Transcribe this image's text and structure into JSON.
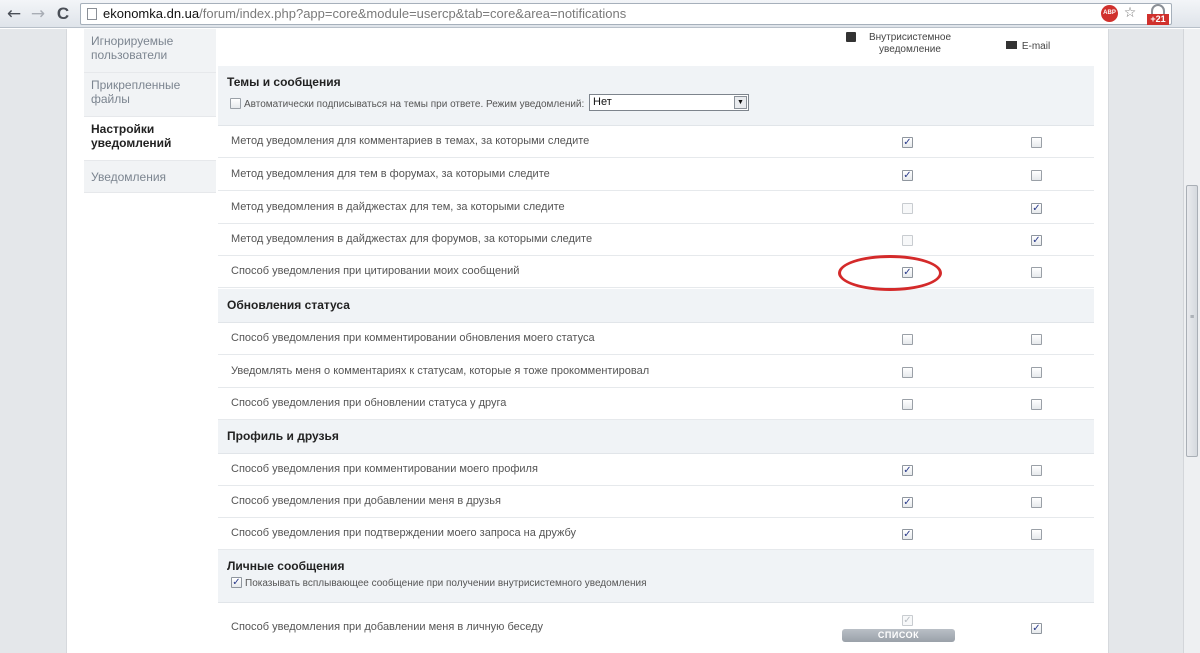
{
  "browser": {
    "back_glyph": "←",
    "forward_glyph": "→",
    "reload_glyph": "C",
    "url_host": "ekonomka.dn.ua",
    "url_path": "/forum/index.php?app=core&module=usercp&tab=core&area=notifications",
    "adblock_label": "ABP",
    "star_glyph": "☆",
    "extension_badge": "+21"
  },
  "sidebar": {
    "items": [
      {
        "label": "Игнорируемые пользователи",
        "active": false
      },
      {
        "label": "Прикрепленные файлы",
        "active": false
      },
      {
        "label": "Настройки уведомлений",
        "active": true
      },
      {
        "label": "Уведомления",
        "active": false
      }
    ]
  },
  "columns": {
    "inline": "Внутрисистемное уведомление",
    "email": "E-mail"
  },
  "sections": [
    {
      "title": "Темы и сообщения",
      "auto_subscribe_label": "Автоматически подписываться на темы при ответе. Режим уведомлений:",
      "auto_subscribe_checked": false,
      "mode_select_value": "Нет",
      "rows": [
        {
          "label": "Метод уведомления для комментариев в темах, за которыми следите",
          "inline": true,
          "email": false,
          "inline_disabled": false
        },
        {
          "label": "Метод уведомления для тем в форумах, за которыми следите",
          "inline": true,
          "email": false,
          "inline_disabled": false
        },
        {
          "label": "Метод уведомления в дайджестах для тем, за которыми следите",
          "inline": false,
          "email": true,
          "inline_disabled": true
        },
        {
          "label": "Метод уведомления в дайджестах для форумов, за которыми следите",
          "inline": false,
          "email": true,
          "inline_disabled": true
        },
        {
          "label": "Способ уведомления при цитировании моих сообщений",
          "inline": true,
          "email": false,
          "inline_disabled": false
        }
      ]
    },
    {
      "title": "Обновления статуса",
      "rows": [
        {
          "label": "Способ уведомления при комментировании обновления моего статуса",
          "inline": false,
          "email": false,
          "inline_disabled": false
        },
        {
          "label": "Уведомлять меня о комментариях к статусам, которые я тоже прокомментировал",
          "inline": false,
          "email": false,
          "inline_disabled": false
        },
        {
          "label": "Способ уведомления при обновлении статуса у друга",
          "inline": false,
          "email": false,
          "inline_disabled": false
        }
      ]
    },
    {
      "title": "Профиль и друзья",
      "rows": [
        {
          "label": "Способ уведомления при комментировании моего профиля",
          "inline": true,
          "email": false,
          "inline_disabled": false
        },
        {
          "label": "Способ уведомления при добавлении меня в друзья",
          "inline": true,
          "email": false,
          "inline_disabled": false
        },
        {
          "label": "Способ уведомления при подтверждении моего запроса на дружбу",
          "inline": true,
          "email": false,
          "inline_disabled": false
        }
      ]
    },
    {
      "title": "Личные сообщения",
      "popup_label": "Показывать всплывающее сообщение при получении внутрисистемного уведомления",
      "popup_checked": true,
      "rows": [
        {
          "label": "Способ уведомления при добавлении меня в личную беседу",
          "inline": true,
          "email": true,
          "inline_disabled": true,
          "list_button": "СПИСОК"
        }
      ]
    }
  ],
  "colors": {
    "highlight_ellipse": "#d42a2a",
    "section_bg": "#f0f3f6",
    "check_color": "#2a3a8a"
  },
  "icons": [
    "back-arrow-icon",
    "forward-arrow-icon",
    "reload-icon",
    "page-icon",
    "adblock-icon",
    "star-icon",
    "extension-icon",
    "inline-notification-icon",
    "mail-icon"
  ]
}
